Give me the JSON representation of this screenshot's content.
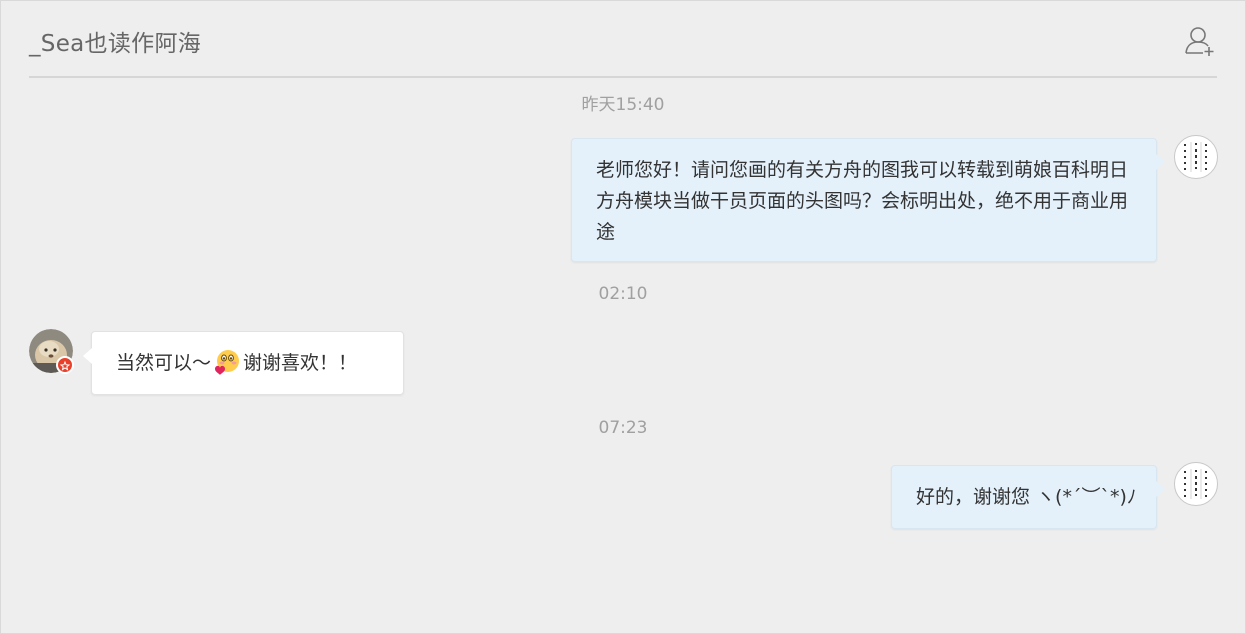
{
  "header": {
    "title": "_Sea也读作阿海",
    "add_contact_icon": "add-user-icon"
  },
  "messages": [
    {
      "time": "昨天15:40",
      "sender": "self",
      "text": "老师您好！请问您画的有关方舟的图我可以转载到萌娘百科明日方舟模块当做干员页面的头图吗？会标明出处，绝不用于商业用途"
    },
    {
      "time": "02:10",
      "sender": "other",
      "text_before": "当然可以～",
      "emoji": "blushing-heart-emoji",
      "text_after": "谢谢喜欢！！"
    },
    {
      "time": "07:23",
      "sender": "self",
      "text": "好的，谢谢您 ヽ(*´︶`*)ﾉ"
    }
  ],
  "colors": {
    "background": "#eeeeee",
    "self_bubble": "#e4f1fb",
    "other_bubble": "#ffffff",
    "time_text": "#a0a0a0",
    "badge": "#e8402a"
  }
}
